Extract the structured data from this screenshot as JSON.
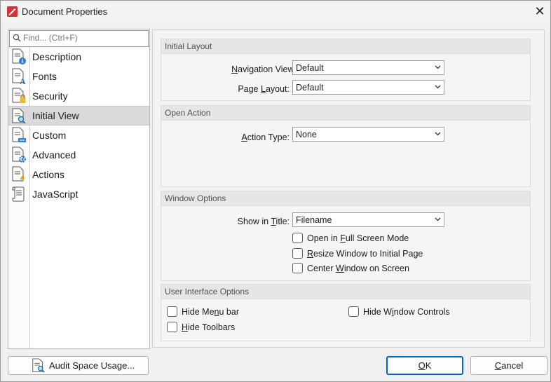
{
  "window": {
    "title": "Document Properties",
    "close_glyph": "✕"
  },
  "search": {
    "placeholder": "Find... (Ctrl+F)"
  },
  "sidebar": {
    "items": [
      {
        "label": "Description",
        "icon": "document-info-icon",
        "selected": false
      },
      {
        "label": "Fonts",
        "icon": "document-font-icon",
        "selected": false
      },
      {
        "label": "Security",
        "icon": "document-lock-icon",
        "selected": false
      },
      {
        "label": "Initial View",
        "icon": "document-magnifier-icon",
        "selected": true
      },
      {
        "label": "Custom",
        "icon": "document-custom-icon",
        "selected": false
      },
      {
        "label": "Advanced",
        "icon": "document-gear-icon",
        "selected": false
      },
      {
        "label": "Actions",
        "icon": "document-lightning-icon",
        "selected": false
      },
      {
        "label": "JavaScript",
        "icon": "scroll-icon",
        "selected": false
      }
    ]
  },
  "initial_layout": {
    "header": "Initial Layout",
    "nav_view": {
      "label_pre": "",
      "label_key": "N",
      "label_post": "avigation View:",
      "value": "Default"
    },
    "page_layout": {
      "label_pre": "Page ",
      "label_key": "L",
      "label_post": "ayout:",
      "value": "Default"
    }
  },
  "open_action": {
    "header": "Open Action",
    "action_type": {
      "label_pre": "",
      "label_key": "A",
      "label_post": "ction Type:",
      "value": "None"
    }
  },
  "window_options": {
    "header": "Window Options",
    "show_in_title": {
      "label_pre": "Show in ",
      "label_key": "T",
      "label_post": "itle:",
      "value": "Filename"
    },
    "full_screen": {
      "pre": "Open in ",
      "key": "F",
      "post": "ull Screen Mode",
      "checked": false
    },
    "resize": {
      "pre": "",
      "key": "R",
      "post": "esize Window to Initial Page",
      "checked": false
    },
    "center": {
      "pre": "Center ",
      "key": "W",
      "post": "indow on Screen",
      "checked": false
    }
  },
  "ui_options": {
    "header": "User Interface Options",
    "hide_menu": {
      "pre": "Hide Me",
      "key": "n",
      "post": "u bar",
      "checked": false
    },
    "hide_toolbars": {
      "pre": "",
      "key": "H",
      "post": "ide Toolbars",
      "checked": false
    },
    "hide_window_controls": {
      "pre": "Hide W",
      "key": "i",
      "post": "ndow Controls",
      "checked": false
    }
  },
  "buttons": {
    "audit": "Audit Space Usage...",
    "ok_key": "O",
    "ok_post": "K",
    "cancel_key": "C",
    "cancel_post": "ancel"
  },
  "colors": {
    "accent": "#0067c0",
    "app_icon": "#d9302c",
    "selection": "#d9d9d9"
  }
}
